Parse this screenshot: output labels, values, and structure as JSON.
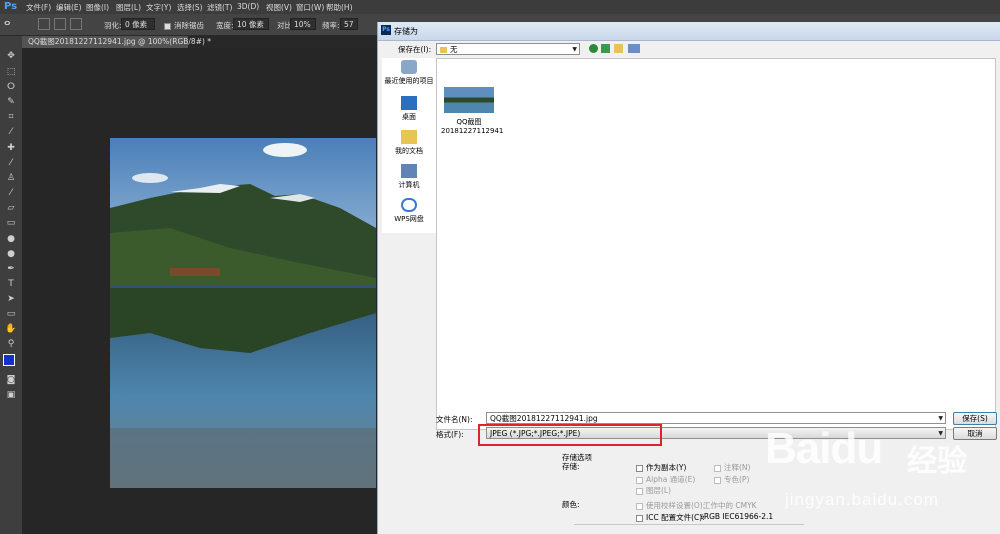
{
  "app": {
    "logo": "Ps",
    "menu": [
      "文件(F)",
      "编辑(E)",
      "图像(I)",
      "图层(L)",
      "文字(Y)",
      "选择(S)",
      "滤镜(T)",
      "3D(D)",
      "视图(V)",
      "窗口(W)",
      "帮助(H)"
    ]
  },
  "options_bar": {
    "feather_label": "羽化:",
    "feather_value": "0 像素",
    "antialias_label": "消除锯齿",
    "width_label": "宽度:",
    "width_value": "10 像素",
    "contrast_label": "对比度:",
    "contrast_value": "10%",
    "frequency_label": "频率:",
    "frequency_value": "57"
  },
  "document": {
    "tab_title": "QQ截图20181227112941.jpg @ 100%(RGB/8#) *"
  },
  "dialog": {
    "title": "存储为",
    "save_in_label": "保存在(I):",
    "save_in_value": "无",
    "places": [
      "最近使用的项目",
      "桌面",
      "我的文档",
      "计算机",
      "WPS网盘"
    ],
    "file": {
      "name_line1": "QQ截图",
      "name_line2": "20181227112941"
    },
    "filename_label": "文件名(N):",
    "filename_value": "QQ截图20181227112941.jpg",
    "format_label": "格式(F):",
    "format_value": "JPEG (*.JPG;*.JPEG;*.JPE)",
    "save_button": "保存(S)",
    "cancel_button": "取消",
    "save_options_title": "存储选项",
    "storage_label": "存储:",
    "as_copy": "作为副本(Y)",
    "annotations": "注释(N)",
    "alpha": "Alpha 通道(E)",
    "spot_colors": "专色(P)",
    "layers": "图层(L)",
    "color_label": "颜色:",
    "use_proof": "使用校样设置(O):",
    "proof_value": "工作中的 CMYK",
    "icc_label": "ICC 配置文件(C):",
    "icc_value": "sRGB IEC61966-2.1"
  },
  "watermark": {
    "brand": "Baidu",
    "suffix": "经验",
    "url": "jingyan.baidu.com"
  },
  "colors": {
    "ps_blue": "#4aa3ff",
    "highlight_red": "#d8262a",
    "fg_color": "#1432c8"
  }
}
